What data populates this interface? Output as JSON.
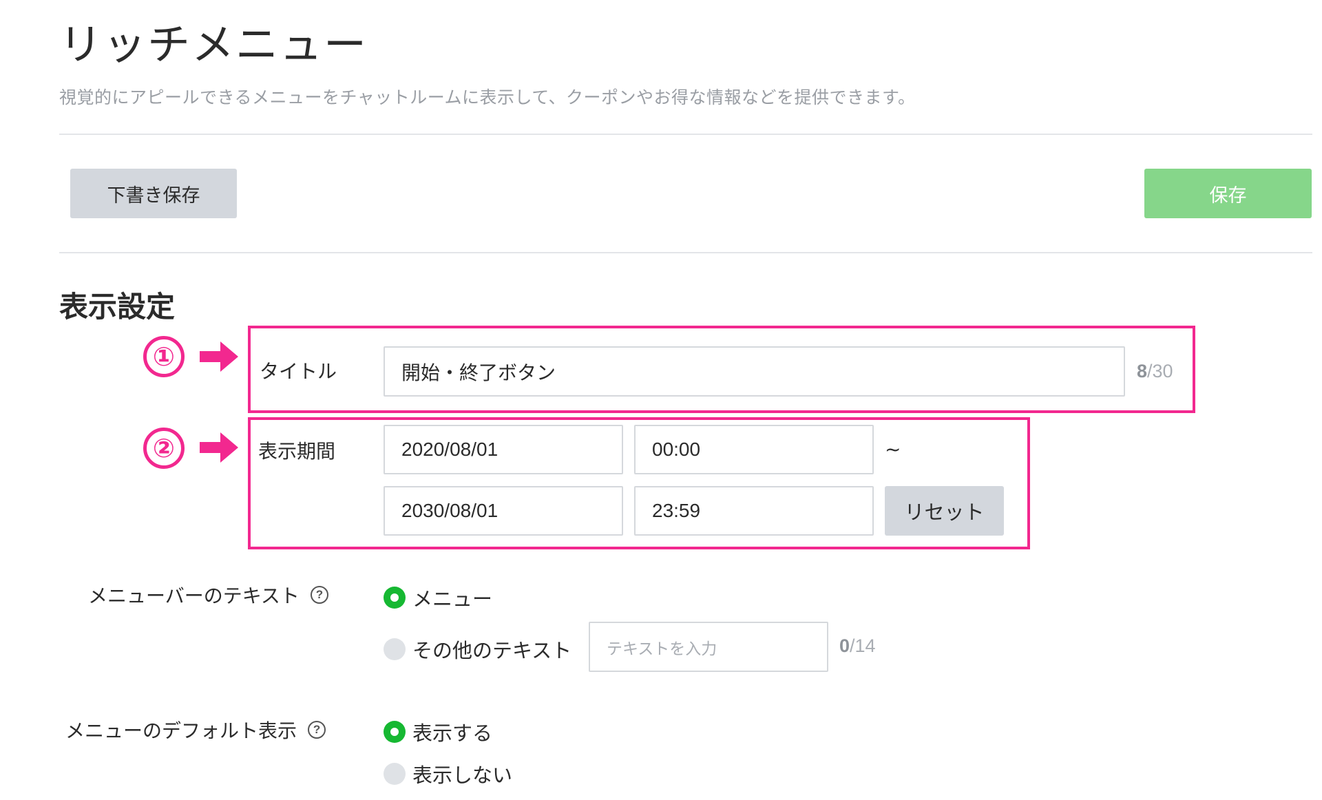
{
  "header": {
    "title": "リッチメニュー",
    "description": "視覚的にアピールできるメニューをチャットルームに表示して、クーポンやお得な情報などを提供できます。"
  },
  "toolbar": {
    "draft_label": "下書き保存",
    "save_label": "保存"
  },
  "display_settings": {
    "section_title": "表示設定",
    "annotations": {
      "marker_1": "①",
      "marker_2": "②",
      "accent_color": "#f2288f"
    },
    "title_field": {
      "label": "タイトル",
      "value": "開始・終了ボタン",
      "count_current": "8",
      "count_max": "/30"
    },
    "period": {
      "label": "表示期間",
      "start_date": "2020/08/01",
      "start_time": "00:00",
      "separator": "~",
      "end_date": "2030/08/01",
      "end_time": "23:59",
      "reset_label": "リセット"
    },
    "menubar_text": {
      "label": "メニューバーのテキスト",
      "help_icon": "?",
      "option_menu": "メニュー",
      "option_other": "その他のテキスト",
      "other_placeholder": "テキストを入力",
      "count_current": "0",
      "count_max": "/14",
      "selected": "メニュー"
    },
    "default_display": {
      "label": "メニューのデフォルト表示",
      "help_icon": "?",
      "option_show": "表示する",
      "option_hide": "表示しない",
      "selected": "表示する"
    }
  },
  "colors": {
    "primary_green": "#16b832",
    "save_button": "#86d68a",
    "secondary_button": "#d3d7dd"
  }
}
